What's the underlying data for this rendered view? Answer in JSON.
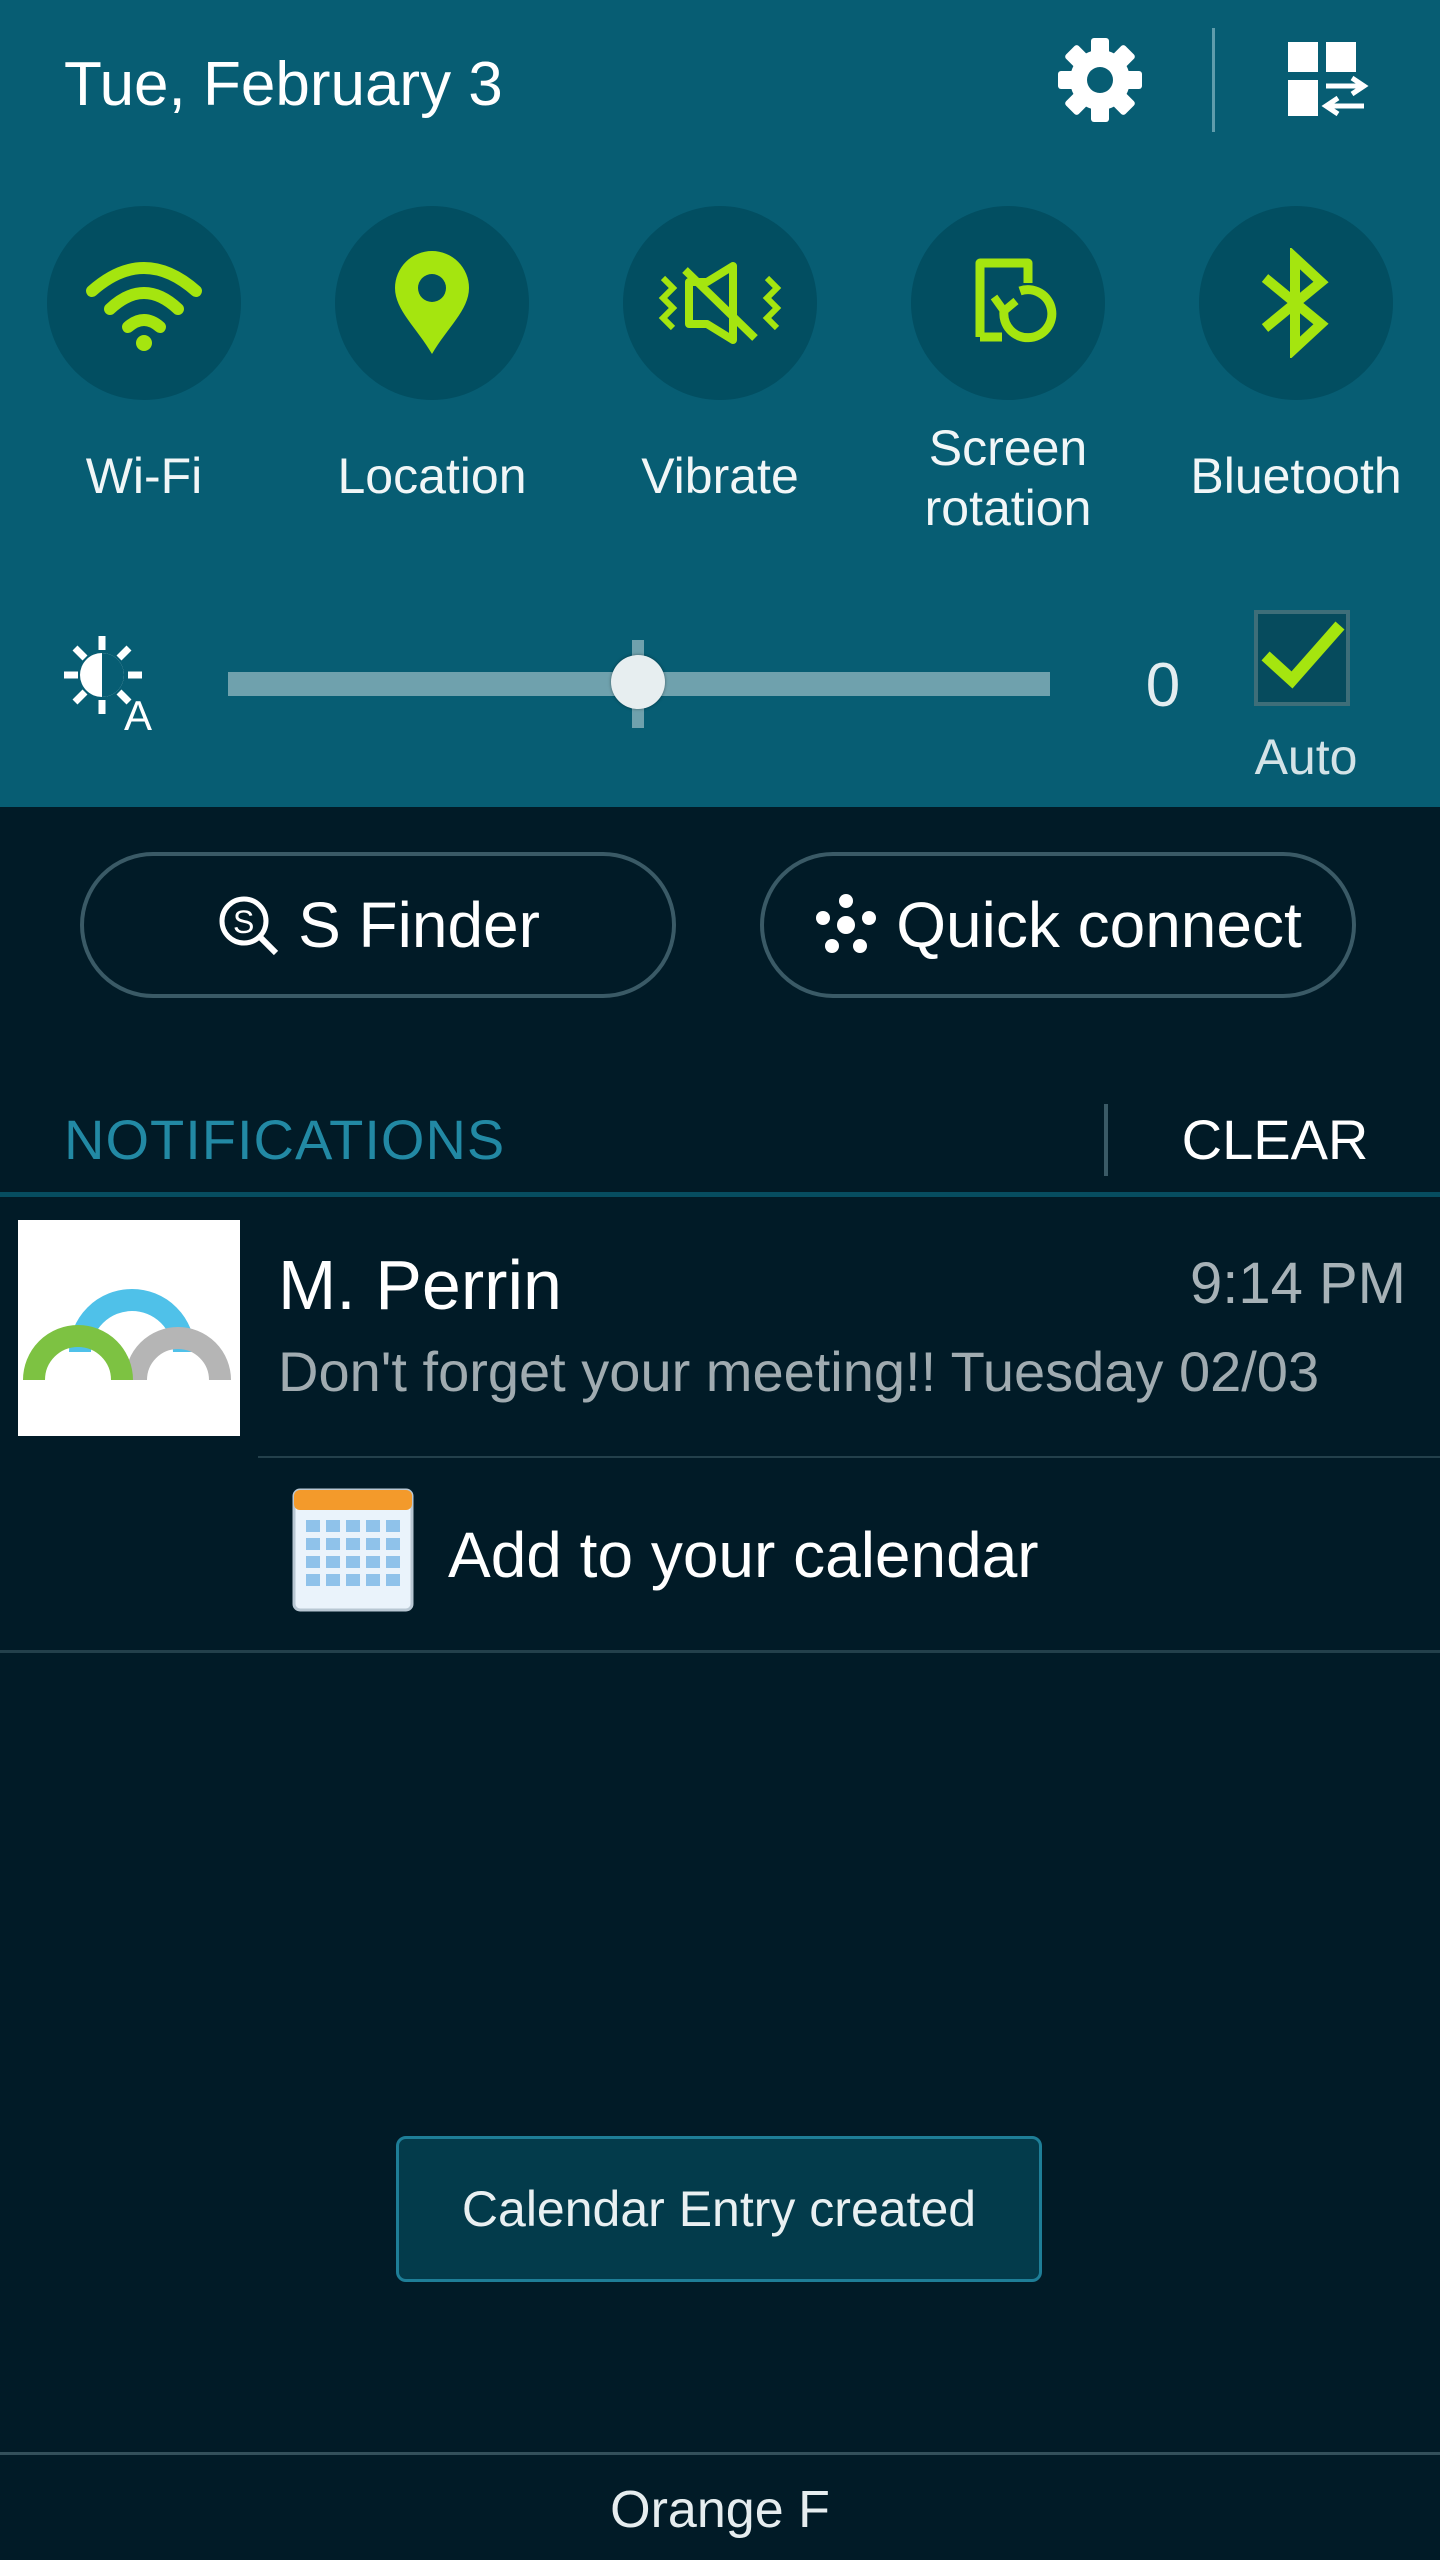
{
  "header": {
    "date": "Tue, February 3",
    "settings_icon": "gear-icon",
    "edit_icon": "grid-edit-icon"
  },
  "quick_settings": {
    "accent_color": "#a5e50f",
    "toggles": [
      {
        "label": "Wi-Fi",
        "icon": "wifi-icon",
        "active": true
      },
      {
        "label": "Location",
        "icon": "location-pin-icon",
        "active": true
      },
      {
        "label": "Vibrate",
        "icon": "vibrate-icon",
        "active": true
      },
      {
        "label": "Screen rotation",
        "icon": "screen-rotation-icon",
        "active": true
      },
      {
        "label": "Bluetooth",
        "icon": "bluetooth-icon",
        "active": true
      }
    ]
  },
  "brightness": {
    "icon": "auto-brightness-icon",
    "value": "0",
    "level": 0.5,
    "auto_label": "Auto",
    "auto_checked": true
  },
  "actions": {
    "s_finder": "S Finder",
    "quick_connect": "Quick connect"
  },
  "notifications": {
    "heading": "NOTIFICATIONS",
    "clear_label": "CLEAR",
    "items": [
      {
        "sender": "M. Perrin",
        "time": "9:14 PM",
        "message": "Don't forget your meeting!! Tuesday 02/03",
        "action": "Add to your calendar"
      }
    ]
  },
  "toast": "Calendar Entry created",
  "carrier": "Orange F"
}
